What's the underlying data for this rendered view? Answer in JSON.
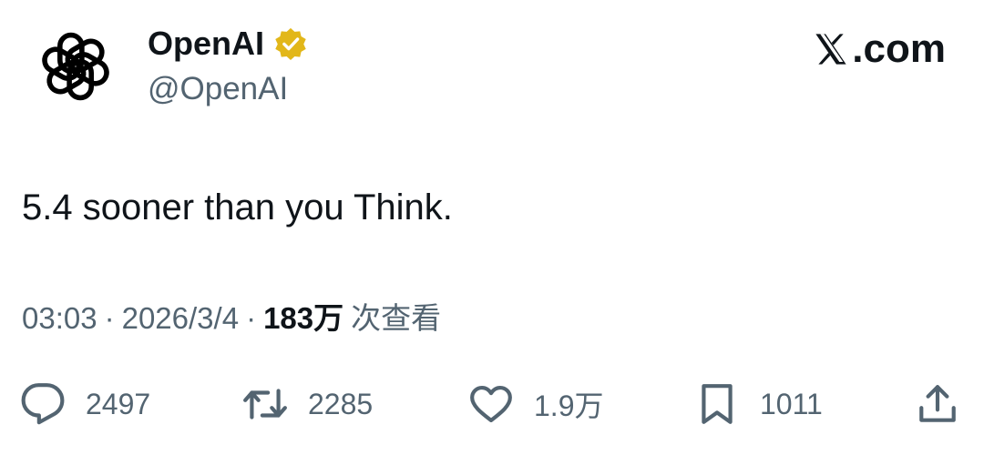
{
  "account": {
    "display_name": "OpenAI",
    "handle": "@OpenAI",
    "verified_icon": "verified-badge-icon",
    "verified_color": "#e2b719"
  },
  "brand": {
    "label": ".com",
    "icon": "x-logo-icon"
  },
  "tweet": {
    "text": "5.4 sooner than you Think."
  },
  "meta": {
    "time": "03:03",
    "date": "2026/3/4",
    "separator": "·",
    "views_count": "183万",
    "views_label": "次查看"
  },
  "actions": {
    "replies": "2497",
    "retweets": "2285",
    "likes": "1.9万",
    "bookmarks": "1011"
  },
  "colors": {
    "text": "#0f1419",
    "muted": "#536471"
  }
}
